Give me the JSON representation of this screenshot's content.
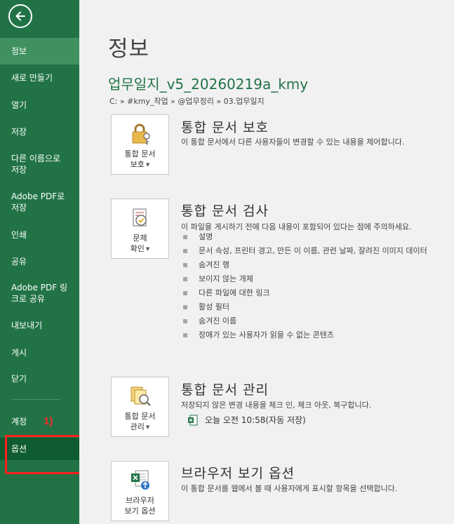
{
  "sidebar": {
    "items": [
      {
        "label": "정보"
      },
      {
        "label": "새로 만들기"
      },
      {
        "label": "열기"
      },
      {
        "label": "저장"
      },
      {
        "label": "다른 이름으로 저장"
      },
      {
        "label": "Adobe PDF로 저장"
      },
      {
        "label": "인쇄"
      },
      {
        "label": "공유"
      },
      {
        "label": "Adobe PDF 링크로 공유"
      },
      {
        "label": "내보내기"
      },
      {
        "label": "게시"
      },
      {
        "label": "닫기"
      },
      {
        "label": "계정"
      },
      {
        "label": "옵션"
      }
    ],
    "annotation": "1)"
  },
  "main": {
    "title": "정보",
    "file_name": "업무일지_v5_20260219a_kmy",
    "file_path": "C: » #kmy_작업 » @업무정리 » 03.업무일지",
    "sections": [
      {
        "button_line1": "통합 문서",
        "button_line2": "보호",
        "title": "통합 문서 보호",
        "description": "이 통합 문서에서 다른 사용자들이 변경할 수 있는 내용을 제어합니다."
      },
      {
        "button_line1": "문제",
        "button_line2": "확인",
        "title": "통합 문서 검사",
        "description": "이 파일을 게시하기 전에 다음 내용이 포함되어 있다는 점에 주의하세요.",
        "bullets": [
          "설명",
          "문서 속성, 프린터 경고, 만든 이 이름, 관련 날짜, 잘려진 이미지 데이터",
          "숨겨진 행",
          "보이지 않는 개체",
          "다른 파일에 대한 링크",
          "활성 필터",
          "숨겨진 이름",
          "장애가 있는 사용자가 읽을 수 없는 콘텐츠"
        ]
      },
      {
        "button_line1": "통합 문서",
        "button_line2": "관리",
        "title": "통합 문서 관리",
        "description": "저장되지 않은 변경 내용을 체크 인, 체크 아웃, 복구합니다.",
        "autosave": "오늘 오전 10:58(자동 저장)"
      },
      {
        "button_line1": "브라우저",
        "button_line2": "보기 옵션",
        "title": "브라우저 보기 옵션",
        "description": "이 통합 문서를 웹에서 볼 때 사용자에게 표시할 항목을 선택합니다."
      }
    ]
  },
  "colors": {
    "sidebar": "#217346",
    "sidebar_active": "#3f915f",
    "sidebar_selected": "#0f5c30",
    "annotation": "#ff1f1f",
    "accent_text": "#217346"
  }
}
